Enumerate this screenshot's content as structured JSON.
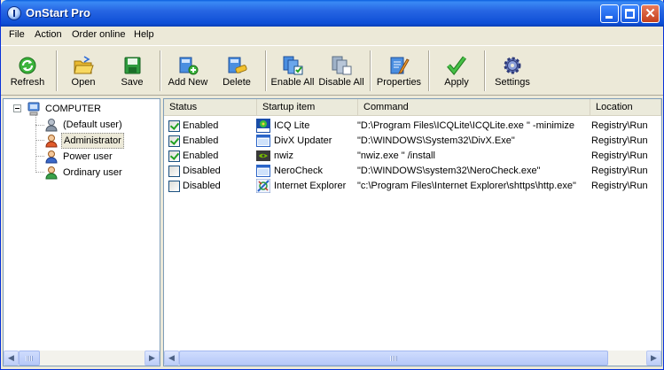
{
  "window": {
    "title": "OnStart Pro"
  },
  "menu": [
    "File",
    "Action",
    "Order online",
    "Help"
  ],
  "toolbar": [
    {
      "label": "Refresh",
      "icon": "refresh-icon"
    },
    {
      "label": "Open",
      "icon": "open-folder-icon"
    },
    {
      "label": "Save",
      "icon": "save-disk-icon"
    },
    {
      "label": "Add New",
      "icon": "add-new-icon"
    },
    {
      "label": "Delete",
      "icon": "delete-icon"
    },
    {
      "label": "Enable All",
      "icon": "enable-all-icon"
    },
    {
      "label": "Disable All",
      "icon": "disable-all-icon"
    },
    {
      "label": "Properties",
      "icon": "properties-icon"
    },
    {
      "label": "Apply",
      "icon": "checkmark-icon"
    },
    {
      "label": "Settings",
      "icon": "gear-icon"
    }
  ],
  "tree": {
    "root": "COMPUTER",
    "users": [
      "(Default user)",
      "Administrator",
      "Power user",
      "Ordinary user"
    ],
    "selected": "Administrator"
  },
  "list": {
    "columns": [
      "Status",
      "Startup item",
      "Command",
      "Location"
    ],
    "rows": [
      {
        "enabled": true,
        "status": "Enabled",
        "item": "ICQ Lite",
        "command": "\"D:\\Program Files\\ICQLite\\ICQLite.exe \" -minimize",
        "location": "Registry\\Run",
        "icon": "icq-lite-icon"
      },
      {
        "enabled": true,
        "status": "Enabled",
        "item": "DivX Updater",
        "command": "\"D:\\WINDOWS\\System32\\DivX.Exe\"",
        "location": "Registry\\Run",
        "icon": "app-window-icon"
      },
      {
        "enabled": true,
        "status": "Enabled",
        "item": "nwiz",
        "command": "\"nwiz.exe \" /install",
        "location": "Registry\\Run",
        "icon": "nvidia-icon"
      },
      {
        "enabled": false,
        "status": "Disabled",
        "item": "NeroCheck",
        "command": "\"D:\\WINDOWS\\system32\\NeroCheck.exe\"",
        "location": "Registry\\Run",
        "icon": "app-window-icon"
      },
      {
        "enabled": false,
        "status": "Disabled",
        "item": "Internet Explorer",
        "command": "\"c:\\Program Files\\Internet Explorer\\shttps\\http.exe\"",
        "location": "Registry\\Run",
        "icon": "internet-explorer-icon"
      }
    ]
  }
}
